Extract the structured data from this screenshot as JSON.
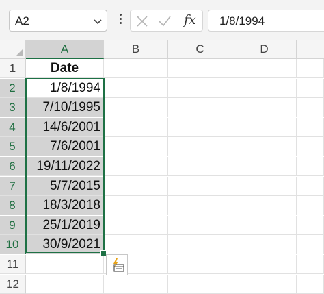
{
  "formula_bar": {
    "name_box": "A2",
    "formula_value": "1/8/1994",
    "fx_label": "fx"
  },
  "columns": [
    "A",
    "B",
    "C",
    "D"
  ],
  "rows": [
    "1",
    "2",
    "3",
    "4",
    "5",
    "6",
    "7",
    "8",
    "9",
    "10",
    "11",
    "12"
  ],
  "column_a": [
    "Date",
    "1/8/1994",
    "7/10/1995",
    "14/6/2001",
    "7/6/2001",
    "19/11/2022",
    "5/7/2015",
    "18/3/2018",
    "25/1/2019",
    "30/9/2021"
  ],
  "colors": {
    "selection": "#1e7145",
    "highlight": "#d3d3d3"
  },
  "icons": {
    "quick_analysis": "quick-analysis-icon"
  }
}
